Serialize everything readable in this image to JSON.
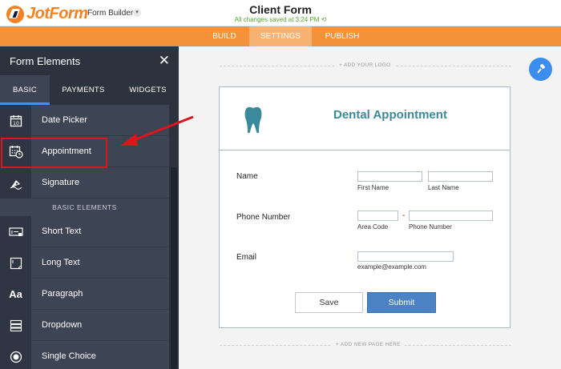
{
  "header": {
    "logo_text": "JotForm",
    "builder_label": "Form Builder",
    "form_title": "Client Form",
    "save_status": "All changes saved at 3:24 PM"
  },
  "nav": {
    "tabs": [
      {
        "label": "BUILD"
      },
      {
        "label": "SETTINGS"
      },
      {
        "label": "PUBLISH"
      }
    ],
    "active": "SETTINGS"
  },
  "sidebar": {
    "title": "Form Elements",
    "close_icon": "close-icon",
    "tabs": [
      {
        "label": "BASIC"
      },
      {
        "label": "PAYMENTS"
      },
      {
        "label": "WIDGETS"
      }
    ],
    "active_tab": "BASIC",
    "items": [
      {
        "label": "Date Picker",
        "icon": "calendar-icon"
      },
      {
        "label": "Appointment",
        "icon": "appointment-icon"
      },
      {
        "label": "Signature",
        "icon": "signature-icon"
      }
    ],
    "section_label": "BASIC ELEMENTS",
    "basic_items": [
      {
        "label": "Short Text",
        "icon": "short-text-icon"
      },
      {
        "label": "Long Text",
        "icon": "long-text-icon"
      },
      {
        "label": "Paragraph",
        "icon": "paragraph-icon",
        "glyph": "Aa"
      },
      {
        "label": "Dropdown",
        "icon": "dropdown-icon"
      },
      {
        "label": "Single Choice",
        "icon": "radio-icon"
      }
    ]
  },
  "canvas": {
    "add_logo": "+ ADD YOUR LOGO",
    "add_page": "+ ADD NEW PAGE HERE",
    "form": {
      "heading": "Dental Appointment",
      "name_label": "Name",
      "first_name": "First Name",
      "last_name": "Last Name",
      "phone_label": "Phone Number",
      "area_code": "Area Code",
      "phone_sep": "-",
      "phone_number": "Phone Number",
      "email_label": "Email",
      "email_hint": "example@example.com",
      "save_label": "Save",
      "submit_label": "Submit"
    }
  },
  "colors": {
    "brand_orange": "#f4923a",
    "sidebar_bg": "#3d4454",
    "accent_blue": "#4a82c3",
    "highlight_red": "#e0141b",
    "title_teal": "#3a8a9b"
  }
}
